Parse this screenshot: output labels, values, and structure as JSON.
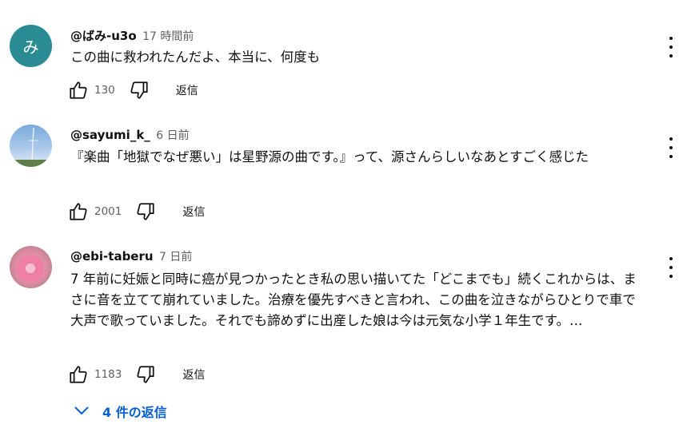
{
  "comments": [
    {
      "avatar_letter": "み",
      "author": "@ばみ-u3o",
      "time": "17 時間前",
      "text": "この曲に救われたんだよ、本当に、何度も",
      "likes": "130",
      "reply_label": "返信"
    },
    {
      "author": "@sayumi_k_",
      "time": "6 日前",
      "text": "『楽曲「地獄でなぜ悪い」は星野源の曲です。』って、源さんらしいなあとすごく感じた",
      "likes": "2001",
      "reply_label": "返信"
    },
    {
      "author": "@ebi-taberu",
      "time": "7 日前",
      "text": " 7 年前に妊娠と同時に癌が見つかったとき私の思い描いてた「どこまでも」続くこれからは、まさに音を立てて崩れていました。治療を優先すべきと言われ、この曲を泣きながらひとりで車で大声で歌っていました。それでも諦めずに出産した娘は今は元気な小学１年生です。…",
      "likes": "1183",
      "reply_label": "返信",
      "replies_label": "4 件の返信"
    }
  ],
  "icons": [
    "thumb-up-icon",
    "thumb-down-icon",
    "more-vert-icon",
    "chevron-down-icon"
  ],
  "colors": {
    "link": "#065fd4",
    "avatar_bg": "#2a8b95",
    "secondary_text": "#606060"
  }
}
